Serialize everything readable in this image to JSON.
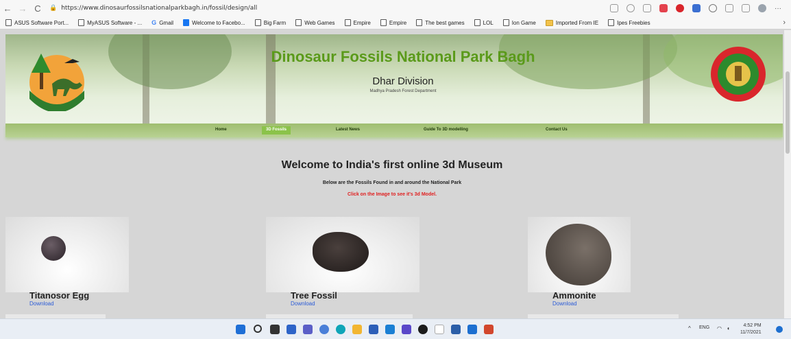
{
  "browser": {
    "url": "https://www.dinosaurfossilsnationalparkbagh.in/fossil/design/all",
    "nav": {
      "back": "←",
      "forward": "→",
      "reload": "C"
    },
    "bookmarks": [
      {
        "label": "ASUS Software Port...",
        "icon": "page-icon"
      },
      {
        "label": "MyASUS Software - ...",
        "icon": "page-icon"
      },
      {
        "label": "Gmail",
        "icon": "gmail-icon"
      },
      {
        "label": "Welcome to Facebo...",
        "icon": "facebook-icon"
      },
      {
        "label": "Big Farm",
        "icon": "page-icon"
      },
      {
        "label": "Web Games",
        "icon": "page-icon"
      },
      {
        "label": "Empire",
        "icon": "page-icon"
      },
      {
        "label": "Empire",
        "icon": "page-icon"
      },
      {
        "label": "The best games",
        "icon": "page-icon"
      },
      {
        "label": "LOL",
        "icon": "page-icon"
      },
      {
        "label": "Ion Game",
        "icon": "page-icon"
      },
      {
        "label": "Imported From IE",
        "icon": "folder-icon"
      },
      {
        "label": "Ipes Freebies",
        "icon": "page-icon"
      }
    ],
    "more": "›"
  },
  "site": {
    "title": "Dinosaur Fossils National Park Bagh",
    "division": "Dhar Division",
    "department": "Madhya Pradesh Forest Department",
    "colors": {
      "title": "#5a9a1a",
      "menu_active": "#8bc34a",
      "hint": "#e02020",
      "link": "#2a5bd7"
    }
  },
  "menu": [
    {
      "label": "Home",
      "active": false
    },
    {
      "label": "3D Fossils",
      "active": true
    },
    {
      "label": "Latest News",
      "active": false
    },
    {
      "label": "Guide To 3D modelling",
      "active": false
    },
    {
      "label": "Contact Us",
      "active": false
    }
  ],
  "main": {
    "heading": "Welcome to India's first online 3d Museum",
    "intro": "Below are the Fossils Found in and around the National Park",
    "hint": "Click on the Image to see it's 3d Model."
  },
  "fossils": [
    {
      "name": "Titanosor Egg",
      "download": "Download"
    },
    {
      "name": "Tree Fossil",
      "download": "Download"
    },
    {
      "name": "Ammonite",
      "download": "Download"
    }
  ],
  "taskbar": {
    "tray": "^",
    "language": "ENG",
    "time": "4:52 PM",
    "date": "11/7/2021"
  }
}
